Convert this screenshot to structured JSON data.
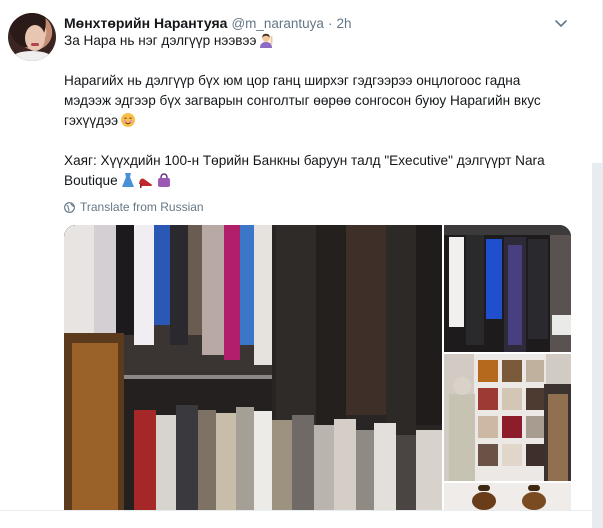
{
  "tweet": {
    "display_name": "Мөнхтөрийн Нарантуяа",
    "handle": "@m_narantuya",
    "separator": "·",
    "timestamp": "2h",
    "text_lines": [
      "За Нара нь нэг дэлгүүр нээвээ",
      "",
      "Нарагийх нь дэлгүүр бүх юм цор ганц ширхэг гэдгээрээ онцлогоос гадна",
      "мэдээж эдгээр бүх загварын сонголтыг өөрөө сонгосон буюу Нарагийн вкус",
      "гэхүүдээ",
      "",
      "Хаяг: Хүүхдийн 100-н Төрийн Банкны баруун талд \"Executive\" дэлгүүрт Nara",
      "Boutique"
    ],
    "translate_label": "Translate from Russian"
  },
  "icons": {
    "avatar": "profile-photo",
    "caret": "chevron-down-icon",
    "globe": "globe-icon",
    "emoji_1": "woman-raising-hand-emoji",
    "emoji_2": "smiling-face-emoji",
    "emoji_3": [
      "dress-emoji",
      "high-heel-emoji",
      "handbag-emoji"
    ]
  },
  "colors": {
    "primary_text": "#14171a",
    "secondary_text": "#657786",
    "rail": "#e6ecf0"
  },
  "media": {
    "count": 4
  }
}
